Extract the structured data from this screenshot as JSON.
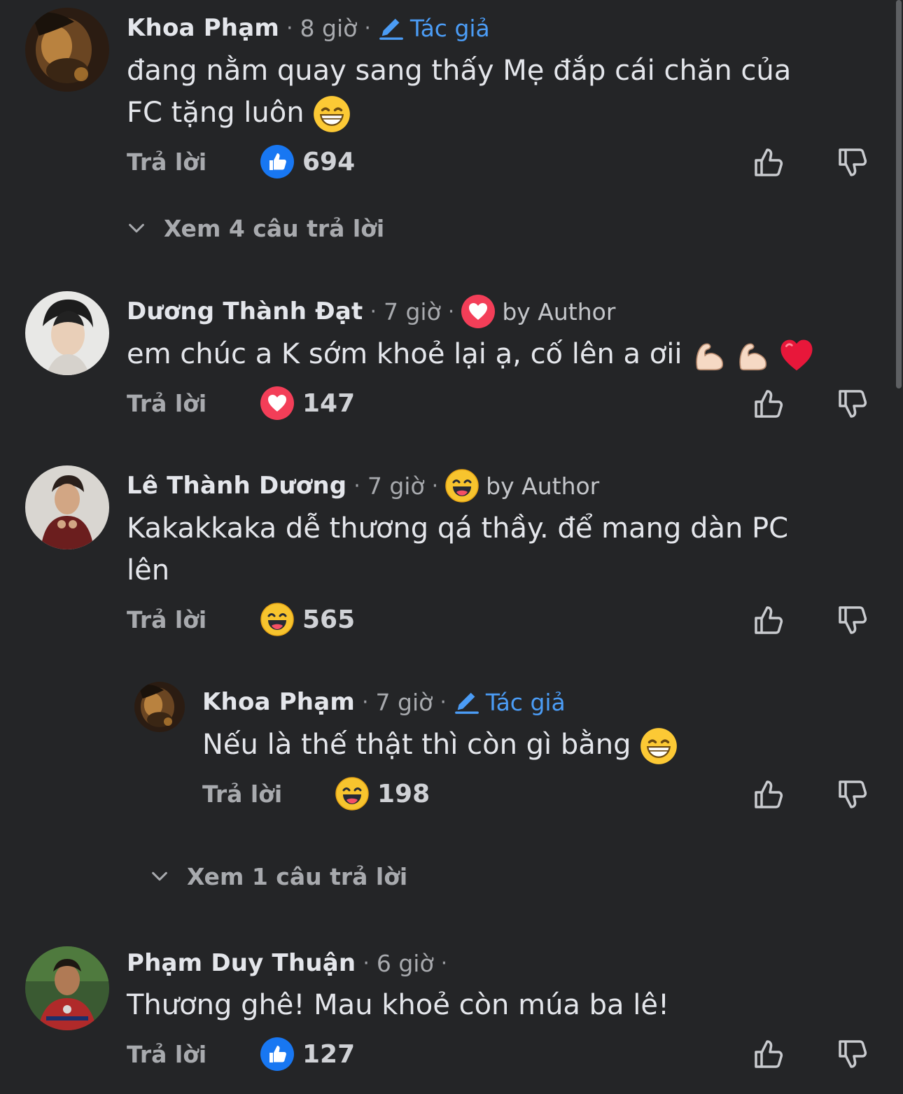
{
  "labels": {
    "reply": "Trả lời",
    "author": "Tác giả",
    "by_author": "by Author",
    "dot": "·"
  },
  "comments": [
    {
      "name": "Khoa Phạm",
      "time": "8 giờ",
      "badge": "author",
      "text": "đang nằm quay sang thấy Mẹ đắp cái chăn của\nFC tặng luôn",
      "text_emoji": "grinning",
      "reaction": "like",
      "count": "694",
      "view_replies": "Xem 4 câu trả lời"
    },
    {
      "name": "Dương Thành Đạt",
      "time": "7 giờ",
      "badge": "by-author-love",
      "text": "em chúc a K sớm khoẻ lại ạ, cố lên a ơii",
      "text_emoji": "muscle muscle heart",
      "reaction": "love",
      "count": "147"
    },
    {
      "name": "Lê Thành Dương",
      "time": "7 giờ",
      "badge": "by-author-haha",
      "text": "Kakakkaka dễ thương qá thầy. để mang dàn PC\nlên",
      "reaction": "haha",
      "count": "565"
    },
    {
      "name": "Khoa Phạm",
      "time": "7 giờ",
      "badge": "author",
      "text": "Nếu là thế thật thì còn gì bằng",
      "text_emoji": "grinning",
      "reaction": "haha",
      "count": "198",
      "view_replies": "Xem 1 câu trả lời",
      "is_reply": true
    },
    {
      "name": "Phạm Duy Thuận",
      "time": "6 giờ",
      "text": "Thương ghê! Mau khoẻ còn múa ba lê!",
      "reaction": "like",
      "count": "127"
    }
  ],
  "colors": {
    "background": "#242527",
    "author_blue": "#4b9cf5",
    "like_blue": "#1877f2",
    "love_red": "#f33e58",
    "haha_yellow": "#f7b125"
  },
  "icons": [
    "thumbs-up-outline-icon",
    "thumbs-down-outline-icon",
    "chevron-down-icon",
    "pencil-icon",
    "like-reaction-icon",
    "love-reaction-icon",
    "haha-reaction-icon"
  ]
}
